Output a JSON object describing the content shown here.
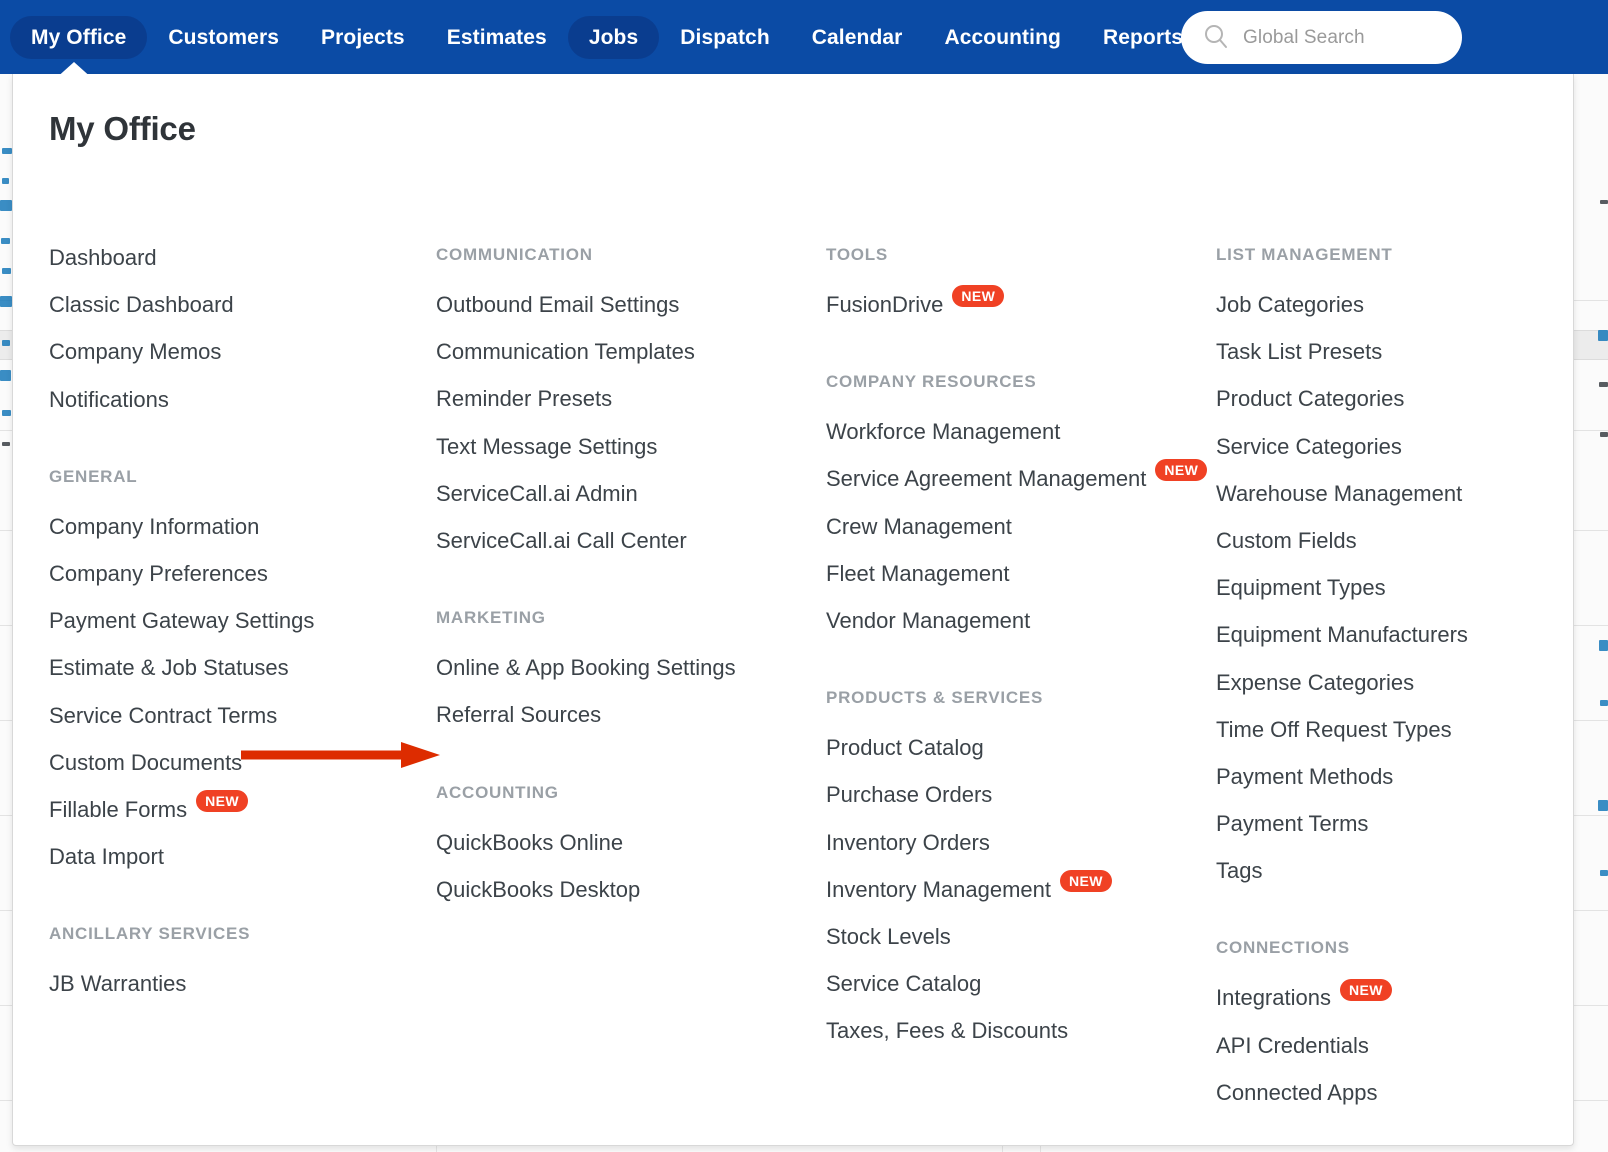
{
  "topnav": {
    "items": [
      {
        "label": "My Office",
        "state": "active"
      },
      {
        "label": "Customers",
        "state": "normal"
      },
      {
        "label": "Projects",
        "state": "normal"
      },
      {
        "label": "Estimates",
        "state": "normal"
      },
      {
        "label": "Jobs",
        "state": "selected"
      },
      {
        "label": "Dispatch",
        "state": "normal"
      },
      {
        "label": "Calendar",
        "state": "normal"
      },
      {
        "label": "Accounting",
        "state": "normal"
      },
      {
        "label": "Reports",
        "state": "normal"
      }
    ],
    "search": {
      "placeholder": "Global Search",
      "value": "",
      "icon": "search-icon"
    }
  },
  "panel": {
    "title": "My Office",
    "columns": [
      {
        "id": "col-1",
        "groups": [
          {
            "heading": "",
            "items": [
              {
                "label": "Dashboard"
              },
              {
                "label": "Classic Dashboard"
              },
              {
                "label": "Company Memos"
              },
              {
                "label": "Notifications"
              }
            ]
          },
          {
            "heading": "GENERAL",
            "items": [
              {
                "label": "Company Information"
              },
              {
                "label": "Company Preferences"
              },
              {
                "label": "Payment Gateway Settings"
              },
              {
                "label": "Estimate & Job Statuses"
              },
              {
                "label": "Service Contract Terms"
              },
              {
                "label": "Custom Documents"
              },
              {
                "label": "Fillable Forms",
                "badge": "NEW"
              },
              {
                "label": "Data Import"
              }
            ]
          },
          {
            "heading": "ANCILLARY SERVICES",
            "items": [
              {
                "label": "JB Warranties"
              }
            ]
          }
        ]
      },
      {
        "id": "col-2",
        "groups": [
          {
            "heading": "COMMUNICATION",
            "items": [
              {
                "label": "Outbound Email Settings"
              },
              {
                "label": "Communication Templates"
              },
              {
                "label": "Reminder Presets"
              },
              {
                "label": "Text Message Settings"
              },
              {
                "label": "ServiceCall.ai Admin"
              },
              {
                "label": "ServiceCall.ai Call Center"
              }
            ]
          },
          {
            "heading": "MARKETING",
            "items": [
              {
                "label": "Online & App Booking Settings"
              },
              {
                "label": "Referral Sources"
              }
            ]
          },
          {
            "heading": "ACCOUNTING",
            "items": [
              {
                "label": "QuickBooks Online"
              },
              {
                "label": "QuickBooks Desktop"
              }
            ]
          }
        ]
      },
      {
        "id": "col-3",
        "groups": [
          {
            "heading": "TOOLS",
            "items": [
              {
                "label": "FusionDrive",
                "badge": "NEW"
              }
            ]
          },
          {
            "heading": "COMPANY RESOURCES",
            "items": [
              {
                "label": "Workforce Management"
              },
              {
                "label": "Service Agreement Management",
                "badge": "NEW"
              },
              {
                "label": "Crew Management"
              },
              {
                "label": "Fleet Management"
              },
              {
                "label": "Vendor Management"
              }
            ]
          },
          {
            "heading": "PRODUCTS & SERVICES",
            "items": [
              {
                "label": "Product Catalog"
              },
              {
                "label": "Purchase Orders"
              },
              {
                "label": "Inventory Orders"
              },
              {
                "label": "Inventory Management",
                "badge": "NEW"
              },
              {
                "label": "Stock Levels"
              },
              {
                "label": "Service Catalog"
              },
              {
                "label": "Taxes, Fees & Discounts"
              }
            ]
          }
        ]
      },
      {
        "id": "col-4",
        "groups": [
          {
            "heading": "LIST MANAGEMENT",
            "items": [
              {
                "label": "Job Categories"
              },
              {
                "label": "Task List Presets"
              },
              {
                "label": "Product Categories"
              },
              {
                "label": "Service Categories"
              },
              {
                "label": "Warehouse Management"
              },
              {
                "label": "Custom Fields"
              },
              {
                "label": "Equipment Types"
              },
              {
                "label": "Equipment Manufacturers"
              },
              {
                "label": "Expense Categories"
              },
              {
                "label": "Time Off Request Types"
              },
              {
                "label": "Payment Methods"
              },
              {
                "label": "Payment Terms"
              },
              {
                "label": "Tags"
              }
            ]
          },
          {
            "heading": "CONNECTIONS",
            "items": [
              {
                "label": "Integrations",
                "badge": "NEW"
              },
              {
                "label": "API Credentials"
              },
              {
                "label": "Connected Apps"
              }
            ]
          }
        ]
      }
    ]
  },
  "annotation": {
    "arrow": {
      "points_to": "Referral Sources",
      "color": "#dd2c00"
    }
  },
  "colors": {
    "nav_background": "#0b4ba5",
    "nav_pill": "#0a3d8f",
    "badge_new": "#f04124",
    "panel_background": "#ffffff",
    "link_text": "#3c4349",
    "heading_text": "#9aa0a6",
    "annotation_red": "#dd2c00"
  }
}
